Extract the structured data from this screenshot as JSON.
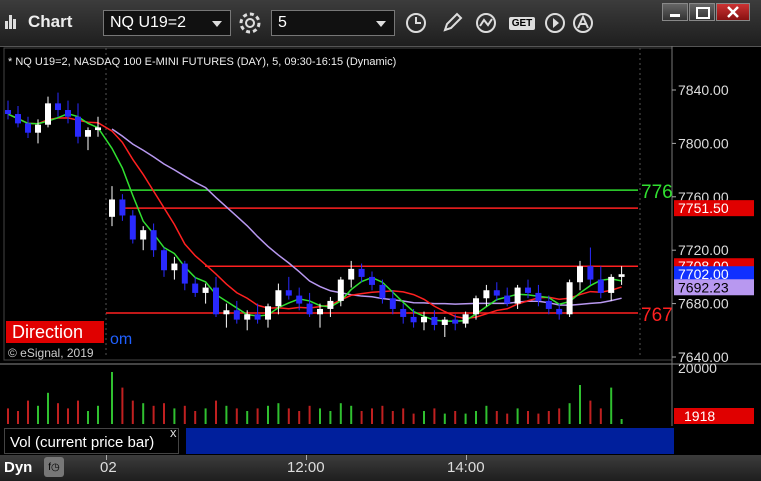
{
  "window": {
    "title": "Chart"
  },
  "toolbar": {
    "symbol": "NQ U19=2",
    "interval": "5",
    "get_label": "GET"
  },
  "chart": {
    "header": "* NQ U19=2, NASDAQ 100 E-MINI FUTURES (DAY), 5, 09:30-16:15 (Dynamic)",
    "copyright": "© eSignal, 2019",
    "direction_label": "Direction",
    "direction_tail": "om",
    "y_ticks": [
      "7840.00",
      "7800.00",
      "7760.00",
      "7720.00",
      "7680.00",
      "7640.00"
    ],
    "price_tags": {
      "line_7765": "776",
      "line_7751": "7751.50",
      "line_7708": "7708.00",
      "current": "7702.00",
      "ma": "7692.23",
      "line_7673": "767"
    },
    "x_ticks": [
      "02",
      "12:00",
      "14:00"
    ],
    "colors": {
      "up": "#ffffff",
      "down": "#2a2aff",
      "red_line": "#ff2020",
      "green_line": "#30e030",
      "ma_purple": "#b898f0",
      "direction": "#e00000"
    }
  },
  "volume": {
    "label": "Vol (current price bar)",
    "close": "x",
    "tick_20000": "20000",
    "current_value": "1918"
  },
  "footer": {
    "dyn_label": "Dyn"
  },
  "chart_data": {
    "type": "candlestick",
    "ylim": [
      7640,
      7850
    ],
    "lines": [
      {
        "value": 7765,
        "color": "#30e030"
      },
      {
        "value": 7751.5,
        "color": "#ff2020"
      },
      {
        "value": 7708,
        "color": "#ff2020"
      },
      {
        "value": 7673,
        "color": "#ff2020"
      }
    ],
    "candles": [
      [
        7825,
        7832,
        7818,
        7822
      ],
      [
        7822,
        7828,
        7812,
        7815
      ],
      [
        7815,
        7820,
        7804,
        7808
      ],
      [
        7808,
        7818,
        7800,
        7814
      ],
      [
        7814,
        7835,
        7812,
        7830
      ],
      [
        7830,
        7838,
        7820,
        7825
      ],
      [
        7825,
        7832,
        7815,
        7820
      ],
      [
        7820,
        7830,
        7800,
        7805
      ],
      [
        7805,
        7812,
        7795,
        7810
      ],
      [
        7810,
        7820,
        7805,
        7812
      ],
      [
        7745,
        7768,
        7738,
        7758
      ],
      [
        7758,
        7762,
        7742,
        7746
      ],
      [
        7746,
        7750,
        7725,
        7728
      ],
      [
        7728,
        7738,
        7720,
        7735
      ],
      [
        7735,
        7740,
        7715,
        7720
      ],
      [
        7720,
        7722,
        7700,
        7705
      ],
      [
        7705,
        7715,
        7698,
        7710
      ],
      [
        7710,
        7712,
        7690,
        7695
      ],
      [
        7695,
        7700,
        7685,
        7688
      ],
      [
        7688,
        7695,
        7680,
        7692
      ],
      [
        7692,
        7700,
        7670,
        7672
      ],
      [
        7672,
        7680,
        7662,
        7675
      ],
      [
        7675,
        7682,
        7665,
        7668
      ],
      [
        7668,
        7675,
        7660,
        7672
      ],
      [
        7672,
        7680,
        7665,
        7668
      ],
      [
        7668,
        7680,
        7662,
        7678
      ],
      [
        7678,
        7695,
        7672,
        7690
      ],
      [
        7690,
        7700,
        7683,
        7686
      ],
      [
        7686,
        7692,
        7675,
        7680
      ],
      [
        7680,
        7688,
        7670,
        7672
      ],
      [
        7672,
        7680,
        7662,
        7676
      ],
      [
        7676,
        7685,
        7670,
        7682
      ],
      [
        7682,
        7700,
        7678,
        7698
      ],
      [
        7698,
        7712,
        7692,
        7706
      ],
      [
        7706,
        7710,
        7696,
        7700
      ],
      [
        7700,
        7704,
        7690,
        7694
      ],
      [
        7694,
        7698,
        7680,
        7684
      ],
      [
        7684,
        7690,
        7672,
        7676
      ],
      [
        7676,
        7680,
        7665,
        7670
      ],
      [
        7670,
        7676,
        7662,
        7666
      ],
      [
        7666,
        7674,
        7660,
        7670
      ],
      [
        7670,
        7675,
        7660,
        7664
      ],
      [
        7664,
        7670,
        7655,
        7668
      ],
      [
        7668,
        7672,
        7660,
        7665
      ],
      [
        7665,
        7674,
        7662,
        7672
      ],
      [
        7672,
        7686,
        7668,
        7684
      ],
      [
        7684,
        7694,
        7678,
        7690
      ],
      [
        7690,
        7696,
        7682,
        7686
      ],
      [
        7686,
        7692,
        7678,
        7680
      ],
      [
        7680,
        7694,
        7676,
        7692
      ],
      [
        7692,
        7698,
        7684,
        7688
      ],
      [
        7688,
        7694,
        7678,
        7682
      ],
      [
        7682,
        7686,
        7672,
        7676
      ],
      [
        7676,
        7680,
        7668,
        7672
      ],
      [
        7672,
        7698,
        7670,
        7696
      ],
      [
        7696,
        7712,
        7690,
        7708
      ],
      [
        7708,
        7722,
        7694,
        7698
      ],
      [
        7698,
        7708,
        7684,
        7688
      ],
      [
        7688,
        7702,
        7682,
        7700
      ],
      [
        7700,
        7708,
        7694,
        7702
      ]
    ],
    "volume_ylim": [
      0,
      20000
    ],
    "volume": [
      6000,
      5000,
      9000,
      7000,
      12000,
      8000,
      6000,
      9000,
      5000,
      7000,
      30000,
      14000,
      9000,
      8000,
      7000,
      8000,
      6000,
      7000,
      5000,
      6000,
      9000,
      7000,
      6000,
      5000,
      6000,
      7000,
      8000,
      6000,
      5000,
      7000,
      6000,
      5000,
      8000,
      7000,
      5000,
      6000,
      7000,
      5000,
      6000,
      4000,
      5000,
      6000,
      4000,
      5000,
      4000,
      5000,
      7000,
      5000,
      4000,
      6000,
      5000,
      4000,
      5000,
      6000,
      8000,
      15000,
      9000,
      6000,
      14000,
      1918
    ]
  }
}
